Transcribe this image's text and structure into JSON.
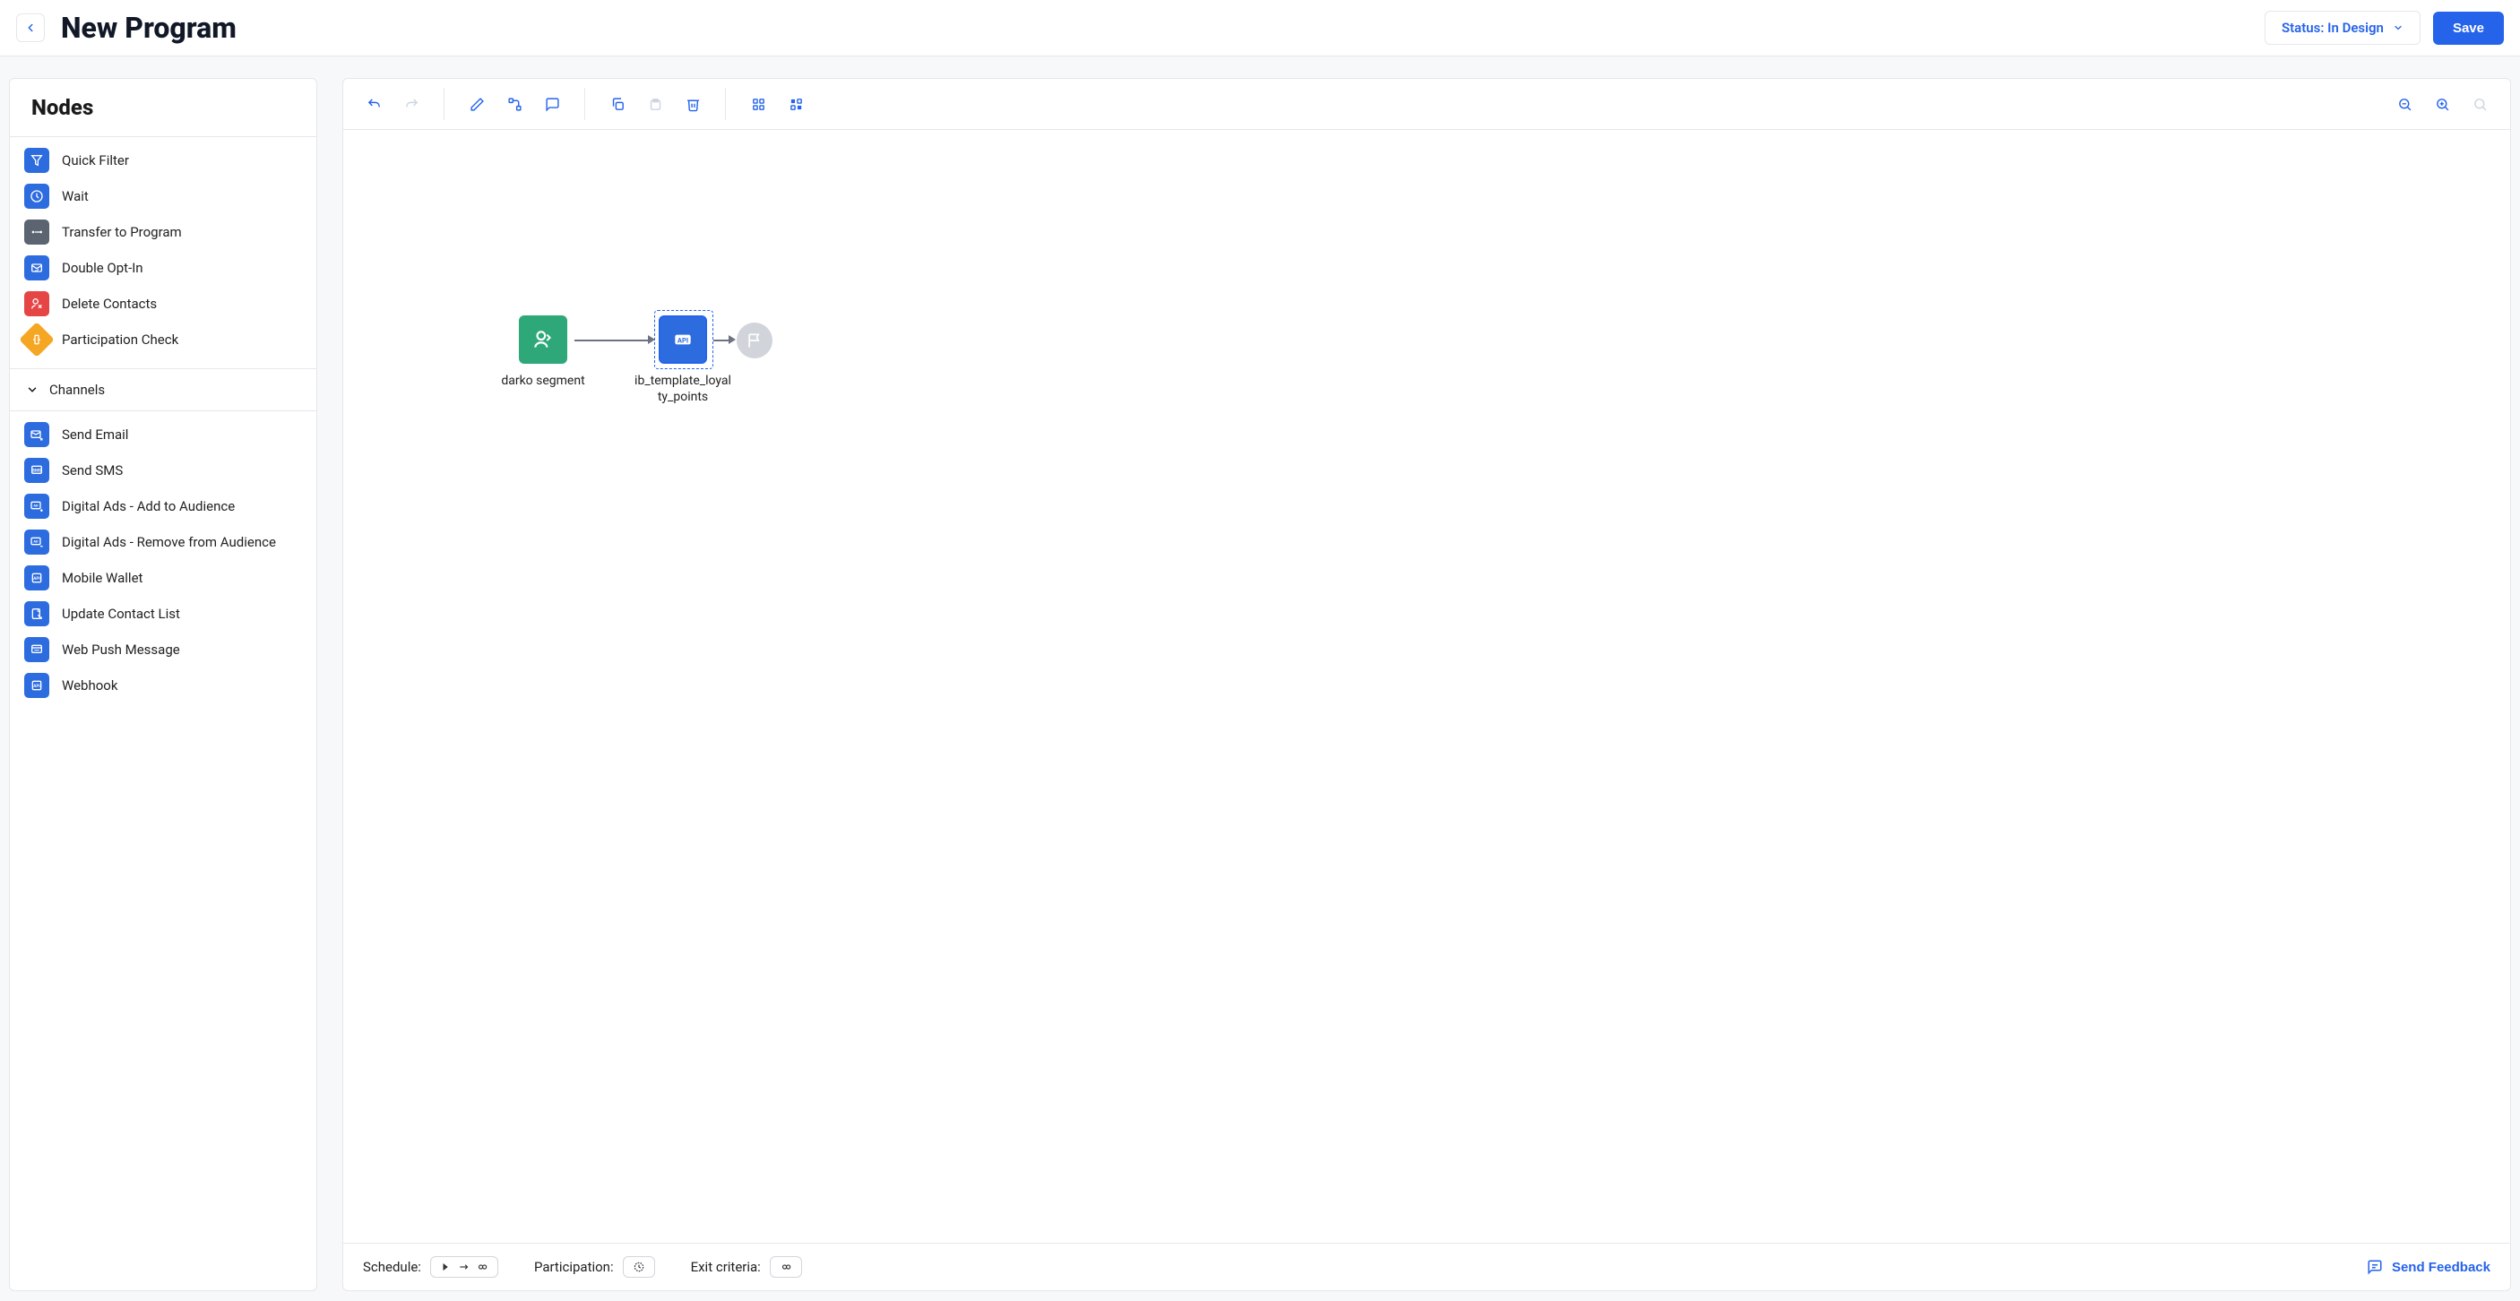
{
  "header": {
    "title": "New Program",
    "status_label": "Status: In Design",
    "save_label": "Save"
  },
  "sidebar": {
    "title": "Nodes",
    "main_nodes": [
      {
        "label": "Quick Filter",
        "icon": "quick-filter",
        "color": "ic-blue"
      },
      {
        "label": "Wait",
        "icon": "wait",
        "color": "ic-blue"
      },
      {
        "label": "Transfer to Program",
        "icon": "transfer",
        "color": "ic-gray"
      },
      {
        "label": "Double Opt-In",
        "icon": "double-opt-in",
        "color": "ic-blue"
      },
      {
        "label": "Delete Contacts",
        "icon": "delete-contacts",
        "color": "ic-red"
      },
      {
        "label": "Participation Check",
        "icon": "participation-check",
        "color": "ic-yellow"
      }
    ],
    "channels_title": "Channels",
    "channel_nodes": [
      {
        "label": "Send Email",
        "icon": "send-email",
        "color": "ic-blue"
      },
      {
        "label": "Send SMS",
        "icon": "send-sms",
        "color": "ic-blue"
      },
      {
        "label": "Digital Ads - Add to Audience",
        "icon": "ads-add",
        "color": "ic-blue"
      },
      {
        "label": "Digital Ads - Remove from Audience",
        "icon": "ads-remove",
        "color": "ic-blue"
      },
      {
        "label": "Mobile Wallet",
        "icon": "mobile-wallet",
        "color": "ic-blue"
      },
      {
        "label": "Update Contact List",
        "icon": "update-list",
        "color": "ic-blue"
      },
      {
        "label": "Web Push Message",
        "icon": "web-push",
        "color": "ic-blue"
      },
      {
        "label": "Webhook",
        "icon": "webhook",
        "color": "ic-blue"
      }
    ]
  },
  "canvas": {
    "nodes": {
      "start": {
        "label": "darko segment"
      },
      "api": {
        "label": "ib_template_loyalty_points"
      }
    }
  },
  "footer": {
    "schedule_label": "Schedule:",
    "participation_label": "Participation:",
    "exit_label": "Exit criteria:",
    "feedback_label": "Send Feedback"
  }
}
